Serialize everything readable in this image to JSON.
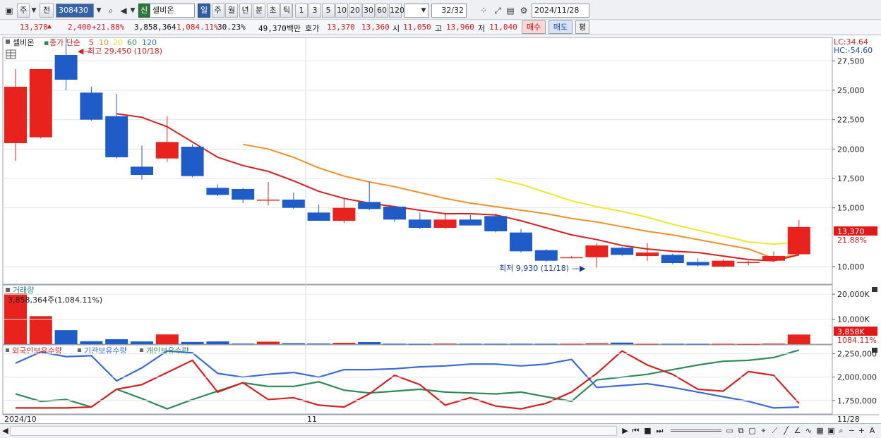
{
  "toolbar": {
    "period_label": "주",
    "prev_label": "전",
    "code": "308430",
    "market_badge": "신",
    "stock_name": "셀비온",
    "timeframes": [
      "일",
      "주",
      "월",
      "년",
      "분",
      "초",
      "틱"
    ],
    "active_timeframe_index": 0,
    "intervals": [
      "1",
      "3",
      "5",
      "10",
      "20",
      "30",
      "60",
      "120"
    ],
    "page_count": "32",
    "page_total": "/32",
    "date": "2024/11/28"
  },
  "quote": {
    "price": "13,370",
    "arrow": "▲",
    "change": "2,400",
    "change_pct": "+21.88%",
    "volume": "3,858,364",
    "volume_pct": "1,084.11%",
    "turnover": "30.23%",
    "amount": "49,370백만",
    "bid_label": "호가",
    "ask": "13,370",
    "bid": "13,360",
    "open_label": "시",
    "open": "11,050",
    "high_label": "고",
    "high": "13,960",
    "low_label": "저",
    "low": "11,040",
    "buy_label": "매수",
    "sell_label": "매도",
    "eval_label": "평"
  },
  "price_pane": {
    "stock_tag": "셀비온",
    "legend_name": "종가 단순",
    "ma_periods": [
      "5",
      "10",
      "20",
      "60",
      "120"
    ],
    "ma_colors": [
      "#d42020",
      "#f0902a",
      "#f0e02a",
      "#2e8b57",
      "#3070c0"
    ],
    "high_note": "최고 29,450 (10/18)",
    "low_note": "최저 9,930 (11/18)",
    "lc": "LC:34.64",
    "hc": "HC:-54.60",
    "current_price_tag": "13,370",
    "current_pct_tag": "21.88%",
    "y_ticks": [
      "27,500",
      "25,000",
      "22,500",
      "20,000",
      "17,500",
      "15,000",
      "10,000"
    ]
  },
  "volume_pane": {
    "title": "거래량",
    "summary": "3,858,364주(1,084.11%)",
    "y_ticks": [
      "20,000K",
      "10,000K"
    ],
    "current_tag": "3,858K",
    "current_pct": "1084.11%"
  },
  "holdings_pane": {
    "legend": [
      "외국인보유수량",
      "기관보유수량",
      "개인보유수량"
    ],
    "legend_colors": [
      "#d42020",
      "#3a6ad8",
      "#2e8b57"
    ],
    "y_ticks": [
      "2,250,000",
      "2,000,000",
      "1,750,000"
    ]
  },
  "x_axis": {
    "labels": [
      "2024/10",
      "11",
      "11/28"
    ]
  },
  "chart_data": {
    "type": "candlestick",
    "ylim": [
      8500,
      29500
    ],
    "candles": [
      {
        "o": 20500,
        "h": 26800,
        "l": 19000,
        "c": 25300
      },
      {
        "o": 21000,
        "h": 26800,
        "l": 20900,
        "c": 26800
      },
      {
        "o": 28000,
        "h": 29450,
        "l": 25000,
        "c": 25900
      },
      {
        "o": 24800,
        "h": 25300,
        "l": 22400,
        "c": 22500
      },
      {
        "o": 22800,
        "h": 24700,
        "l": 19200,
        "c": 19300
      },
      {
        "o": 18500,
        "h": 20300,
        "l": 17400,
        "c": 17800
      },
      {
        "o": 19200,
        "h": 22800,
        "l": 18900,
        "c": 20600
      },
      {
        "o": 20200,
        "h": 20400,
        "l": 17600,
        "c": 17700
      },
      {
        "o": 16700,
        "h": 17000,
        "l": 16000,
        "c": 16100
      },
      {
        "o": 16600,
        "h": 16700,
        "l": 15400,
        "c": 15700
      },
      {
        "o": 15700,
        "h": 17200,
        "l": 15200,
        "c": 15700
      },
      {
        "o": 15700,
        "h": 16300,
        "l": 14900,
        "c": 15000
      },
      {
        "o": 14600,
        "h": 15300,
        "l": 13900,
        "c": 13900
      },
      {
        "o": 13900,
        "h": 15800,
        "l": 13700,
        "c": 15000
      },
      {
        "o": 15500,
        "h": 17200,
        "l": 14800,
        "c": 14900
      },
      {
        "o": 15100,
        "h": 15200,
        "l": 13800,
        "c": 14000
      },
      {
        "o": 14000,
        "h": 14600,
        "l": 13200,
        "c": 13300
      },
      {
        "o": 13300,
        "h": 14600,
        "l": 13200,
        "c": 14000
      },
      {
        "o": 14000,
        "h": 14400,
        "l": 13500,
        "c": 13500
      },
      {
        "o": 14300,
        "h": 14500,
        "l": 12900,
        "c": 13000
      },
      {
        "o": 12900,
        "h": 13200,
        "l": 11200,
        "c": 11300
      },
      {
        "o": 11400,
        "h": 11500,
        "l": 10400,
        "c": 10500
      },
      {
        "o": 10800,
        "h": 10900,
        "l": 10700,
        "c": 10800
      },
      {
        "o": 10800,
        "h": 12000,
        "l": 9930,
        "c": 11800
      },
      {
        "o": 11600,
        "h": 11700,
        "l": 10900,
        "c": 11000
      },
      {
        "o": 10900,
        "h": 12000,
        "l": 10500,
        "c": 11200
      },
      {
        "o": 11000,
        "h": 11100,
        "l": 10200,
        "c": 10300
      },
      {
        "o": 10400,
        "h": 10700,
        "l": 10000,
        "c": 10100
      },
      {
        "o": 10000,
        "h": 10600,
        "l": 9950,
        "c": 10500
      },
      {
        "o": 10300,
        "h": 10500,
        "l": 10100,
        "c": 10400
      },
      {
        "o": 10500,
        "h": 11300,
        "l": 10400,
        "c": 10900
      },
      {
        "o": 11050,
        "h": 13960,
        "l": 11040,
        "c": 13370
      }
    ],
    "ma5": [
      null,
      null,
      null,
      null,
      23000,
      22700,
      21900,
      20600,
      19300,
      18600,
      18100,
      17300,
      16400,
      15800,
      15400,
      15100,
      14800,
      14500,
      14500,
      14400,
      13900,
      13300,
      12700,
      12300,
      11800,
      11500,
      11300,
      11200,
      10900,
      10600,
      10500,
      11000
    ],
    "ma10": [
      null,
      null,
      null,
      null,
      null,
      null,
      null,
      null,
      null,
      20400,
      20000,
      19300,
      18400,
      17700,
      17200,
      16800,
      16300,
      15800,
      15400,
      15100,
      14800,
      14500,
      14100,
      13800,
      13400,
      13000,
      12700,
      12300,
      11900,
      11500,
      10700,
      11000
    ],
    "ma20": [
      null,
      null,
      null,
      null,
      null,
      null,
      null,
      null,
      null,
      null,
      null,
      null,
      null,
      null,
      null,
      null,
      null,
      null,
      null,
      17500,
      17000,
      16300,
      15600,
      15100,
      14700,
      14200,
      13600,
      13100,
      12600,
      12100,
      11900,
      12100
    ],
    "volume": [
      20300,
      11200,
      5600,
      1200,
      2000,
      1100,
      3900,
      900,
      1100,
      250,
      1000,
      400,
      280,
      550,
      850,
      200,
      160,
      250,
      200,
      180,
      200,
      180,
      190,
      380,
      650,
      160,
      180,
      160,
      180,
      120,
      250,
      3858
    ],
    "foreign": [
      1670000,
      1670000,
      1670000,
      1680000,
      1870000,
      1920000,
      2050000,
      2180000,
      1840000,
      1940000,
      1760000,
      1780000,
      1700000,
      1680000,
      1820000,
      2020000,
      1920000,
      1700000,
      1780000,
      1690000,
      1660000,
      1720000,
      1840000,
      2040000,
      2280000,
      2130000,
      2030000,
      1870000,
      1850000,
      2060000,
      2020000,
      1720000
    ],
    "institution": [
      2150000,
      2270000,
      2220000,
      2230000,
      1960000,
      2100000,
      2280000,
      2260000,
      2040000,
      2000000,
      2030000,
      2050000,
      2000000,
      2080000,
      2080000,
      2090000,
      2110000,
      2120000,
      2140000,
      2140000,
      2120000,
      2140000,
      2190000,
      1890000,
      1910000,
      1930000,
      1890000,
      1840000,
      1790000,
      1740000,
      1670000,
      1680000
    ],
    "individual": [
      1820000,
      1740000,
      1760000,
      1680000,
      1870000,
      1770000,
      1660000,
      1760000,
      1850000,
      1940000,
      1900000,
      1900000,
      1950000,
      1860000,
      1830000,
      1850000,
      1870000,
      1840000,
      1830000,
      1820000,
      1840000,
      1790000,
      1740000,
      1970000,
      2000000,
      2030000,
      2080000,
      2130000,
      2170000,
      2180000,
      2210000,
      2290000
    ],
    "holdings_ylim": [
      1620000,
      2300000
    ],
    "volume_ylim": [
      0,
      22000
    ]
  }
}
